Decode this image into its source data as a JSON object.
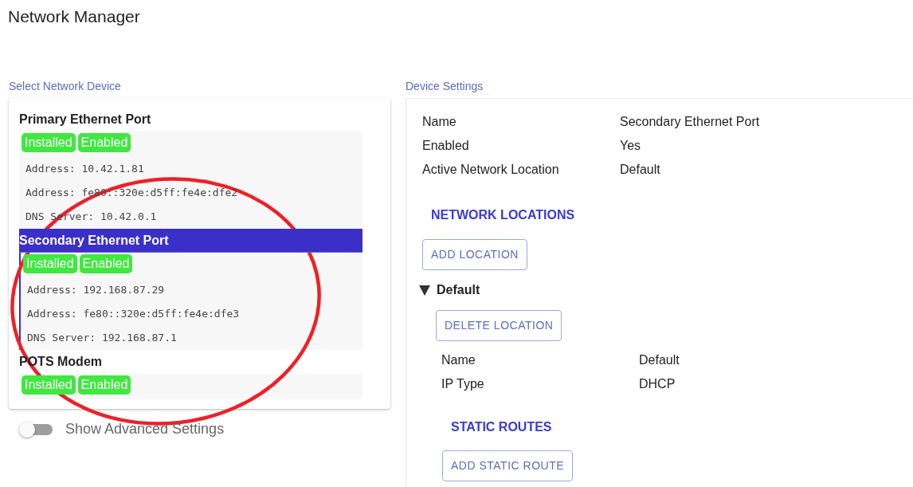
{
  "title": "Network Manager",
  "device_list": {
    "label": "Select Network Device",
    "devices": [
      {
        "name": "Primary Ethernet Port",
        "selected": false,
        "badges": [
          "Installed",
          "Enabled"
        ],
        "details": [
          "Address: 10.42.1.81",
          "Address: fe80::320e:d5ff:fe4e:dfe2",
          "DNS Server: 10.42.0.1"
        ]
      },
      {
        "name": "Secondary Ethernet Port",
        "selected": true,
        "badges": [
          "Installed",
          "Enabled"
        ],
        "details": [
          "Address: 192.168.87.29",
          "Address: fe80::320e:d5ff:fe4e:dfe3",
          "DNS Server: 192.168.87.1"
        ]
      },
      {
        "name": "POTS Modem",
        "selected": false,
        "badges": [
          "Installed",
          "Enabled"
        ]
      }
    ]
  },
  "advanced_toggle": {
    "label": "Show Advanced Settings",
    "on": false
  },
  "settings": {
    "label": "Device Settings",
    "properties": [
      {
        "label": "Name",
        "value": "Secondary Ethernet Port"
      },
      {
        "label": "Enabled",
        "value": "Yes"
      },
      {
        "label": "Active Network Location",
        "value": "Default"
      }
    ],
    "locations_heading": "NETWORK LOCATIONS",
    "add_location_button": "ADD LOCATION",
    "locations": [
      {
        "name": "Default",
        "expanded": true,
        "delete_button": "DELETE LOCATION",
        "properties": [
          {
            "label": "Name",
            "value": "Default"
          },
          {
            "label": "IP Type",
            "value": "DHCP"
          }
        ],
        "routes_heading": "STATIC ROUTES",
        "add_route_button": "ADD STATIC ROUTE"
      }
    ]
  }
}
